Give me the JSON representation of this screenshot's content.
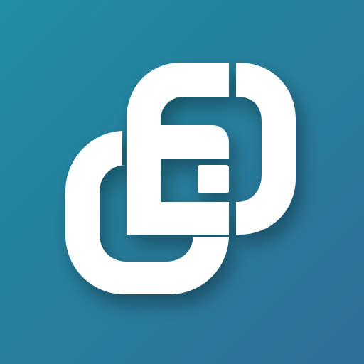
{
  "icon": {
    "name": "interlocking-links-logo-icon",
    "colors": {
      "background_top": "#1f8ea3",
      "background_bottom": "#2f6f97",
      "glyph": "#ffffff",
      "shadow": "#0f4a61"
    }
  }
}
